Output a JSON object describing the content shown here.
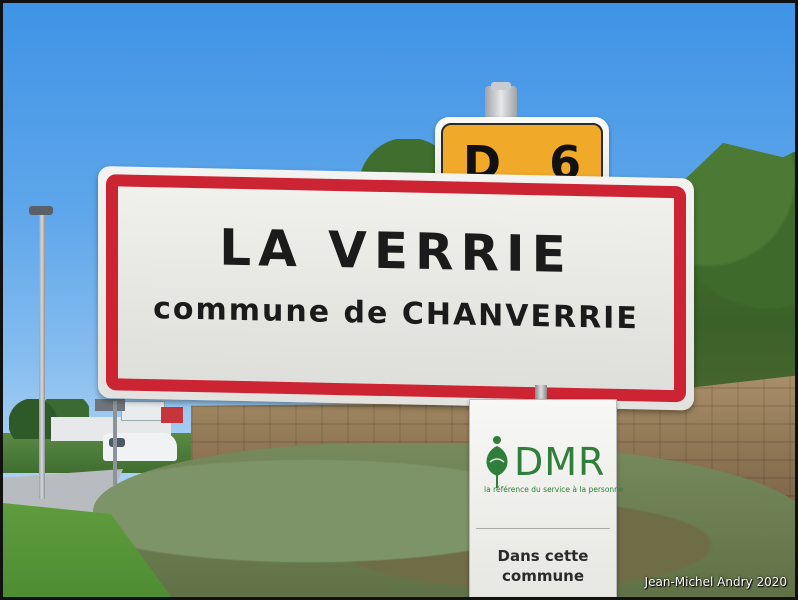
{
  "road_sign": {
    "route_label": "D 6"
  },
  "town_sign": {
    "name": "LA VERRIE",
    "subtitle": "commune de CHANVERRIE",
    "border_color": "#cc2433"
  },
  "dmr_panel": {
    "logo_text": "DMR",
    "tagline": "la référence du service à la personne",
    "line_1": "Dans cette",
    "line_2": "commune",
    "brand_color": "#2f7f3a"
  },
  "credit": "Jean-Michel Andry 2020",
  "icons": [
    "street-lamp-icon",
    "dmr-person-leaf-icon"
  ]
}
